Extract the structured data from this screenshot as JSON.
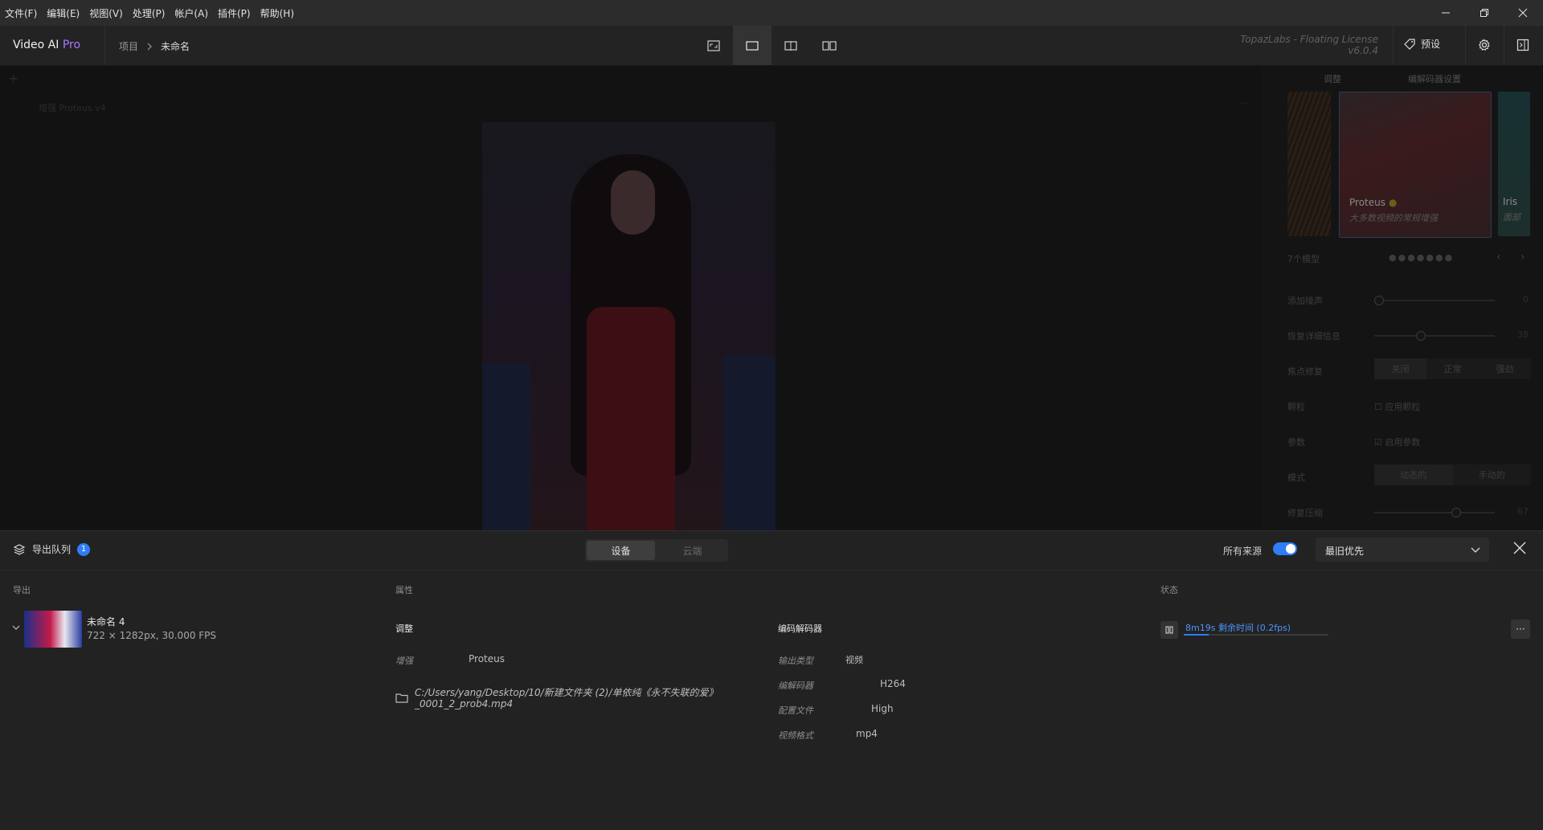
{
  "menubar": {
    "items": [
      "文件(F)",
      "编辑(E)",
      "视图(V)",
      "处理(P)",
      "帐户(A)",
      "插件(P)",
      "帮助(H)"
    ]
  },
  "header": {
    "brand_name": "Video AI",
    "brand_tier": "Pro",
    "breadcrumb_root": "项目",
    "breadcrumb_current": "未命名",
    "license_line1": "TopazLabs - Floating License",
    "license_line2": "v6.0.4",
    "preset_label": "预设"
  },
  "preview": {
    "overlay_text": "增强 Proteus v4"
  },
  "right_panel": {
    "tabs": [
      "调整",
      "编解码器设置"
    ],
    "models": [
      {
        "name": "Proteus",
        "desc": "大多数视频的常规增强"
      },
      {
        "name": "Iris",
        "desc": "面部"
      }
    ],
    "section_label": "7个模型",
    "rows": [
      {
        "label": "添加噪声",
        "value": "0",
        "level": 0.03
      },
      {
        "label": "恢复详细信息",
        "value": "38",
        "level": 0.38
      },
      {
        "label": "焦点修复"
      },
      {
        "label": "颗粒",
        "check_label": "应用颗粒"
      },
      {
        "label": "参数",
        "check_label": "启用参数"
      },
      {
        "label": "模式"
      },
      {
        "label": "修复压缩",
        "value": "67",
        "level": 0.67
      }
    ],
    "focus_options": [
      "关闭",
      "正常",
      "强劲"
    ],
    "mode_options": [
      "动态的",
      "手动的"
    ]
  },
  "queue": {
    "title": "导出队列",
    "count": "1",
    "tabs": [
      "设备",
      "云端"
    ],
    "all_sources_label": "所有来源",
    "sort_label": "最旧优先",
    "col_export": "导出",
    "col_attrs": "属性",
    "col_status": "状态",
    "item": {
      "name": "未命名 4",
      "meta": "722 × 1282px, 30.000 FPS",
      "adjust_title": "调整",
      "enhance_label": "增强",
      "enhance_value": "Proteus",
      "path": "C:/Users/yang/Desktop/10/新建文件夹 (2)/单依纯《永不失联的爱》_0001_2_prob4.mp4",
      "codec_title": "编码解码器",
      "output_type_label": "输出类型",
      "output_type_value": "视频",
      "codec_label": "编解码器",
      "codec_value": "H264",
      "profile_label": "配置文件",
      "profile_value": "High",
      "format_label": "视频格式",
      "format_value": "mp4",
      "status_text": "8m19s 剩余时间 (0.2fps)",
      "progress": 0.17
    }
  },
  "colors": {
    "accent": "#2d7ef7",
    "brand_pro": "#a875ff",
    "status_text": "#4d94ff"
  }
}
